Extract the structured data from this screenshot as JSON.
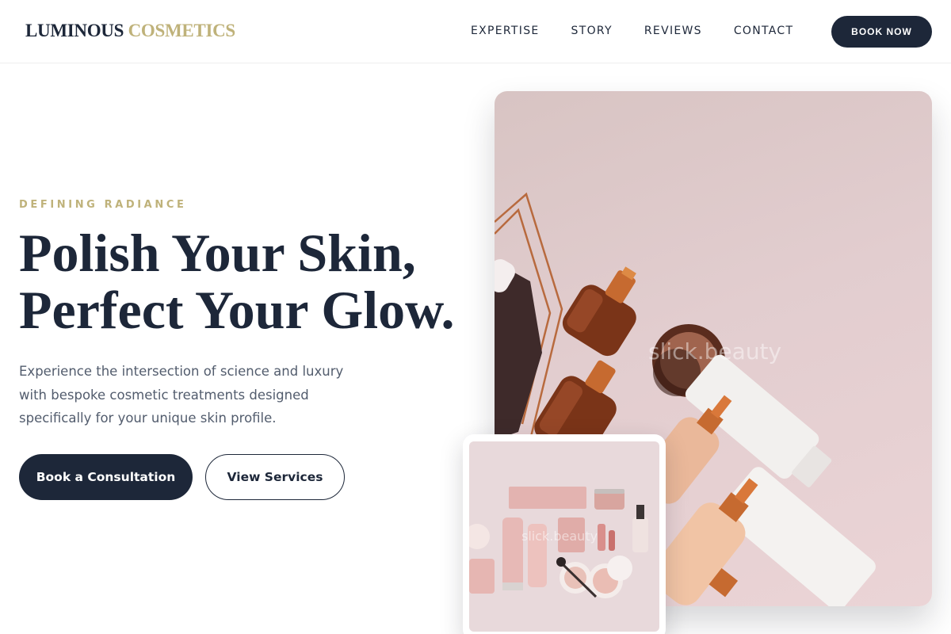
{
  "header": {
    "logo_part1": "LUMINOUS",
    "logo_part2": "COSMETICS",
    "nav": [
      "EXPERTISE",
      "STORY",
      "REVIEWS",
      "CONTACT"
    ],
    "cta": "BOOK NOW"
  },
  "hero": {
    "eyebrow": "DEFINING RADIANCE",
    "headline_line1": "Polish Your Skin,",
    "headline_line2": "Perfect Your Glow.",
    "subtext": "Experience the intersection of science and luxury with bespoke cosmetic treatments designed specifically for your unique skin profile.",
    "primary_button": "Book a Consultation",
    "secondary_button": "View Services"
  },
  "images": {
    "main_watermark": "slick.beauty",
    "card_watermark": "slick.beauty"
  },
  "colors": {
    "navy": "#1d2739",
    "gold": "#bfb27a",
    "body_text": "#525c6d",
    "blush": "#e2cdcf"
  }
}
